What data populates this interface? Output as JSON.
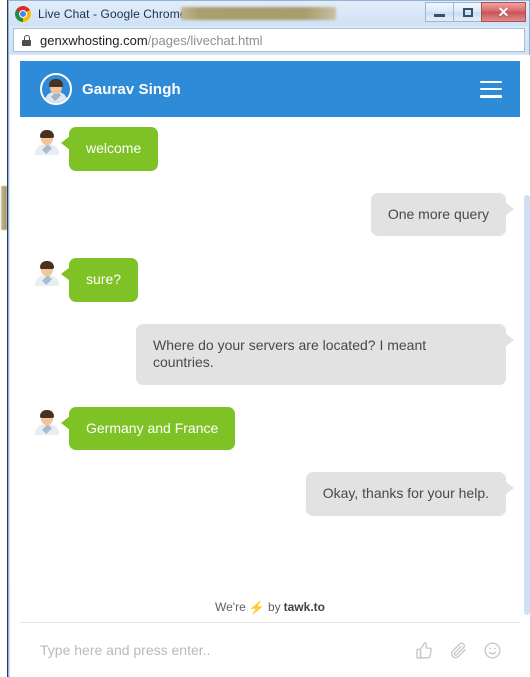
{
  "browser": {
    "window_title": "Live Chat - Google Chrome",
    "title_redacted": true,
    "controls": {
      "minimize_label": "–",
      "maximize_label": "□",
      "close_label": "✕"
    },
    "address_bar": {
      "lock_icon": "lock-icon",
      "host": "genxwhosting.com",
      "path": "/pages/livechat.html"
    }
  },
  "chat": {
    "header": {
      "agent_name": "Gaurav Singh",
      "avatar_icon": "user-avatar-icon",
      "menu_icon": "hamburger-icon",
      "background_color": "#2e8bd8"
    },
    "messages": [
      {
        "sender": "agent",
        "text": "welcome",
        "bubble_color": "#7ec225",
        "has_avatar": true
      },
      {
        "sender": "visitor",
        "text": "One more query",
        "bubble_color": "#e2e2e2",
        "has_avatar": false
      },
      {
        "sender": "agent",
        "text": "sure?",
        "bubble_color": "#7ec225",
        "has_avatar": true
      },
      {
        "sender": "visitor",
        "text": "Where do your servers are located? I meant countries.",
        "bubble_color": "#e2e2e2",
        "has_avatar": false
      },
      {
        "sender": "agent",
        "text": "Germany and France",
        "bubble_color": "#7ec225",
        "has_avatar": true
      },
      {
        "sender": "visitor",
        "text": "Okay, thanks for your help.",
        "bubble_color": "#e2e2e2",
        "has_avatar": false
      }
    ],
    "branding": {
      "prefix": "We're",
      "bolt_icon": "lightning-bolt-icon",
      "middle": "by",
      "brand": "tawk.to"
    },
    "composer": {
      "placeholder": "Type here and press enter..",
      "value": "",
      "actions": [
        {
          "icon": "thumbs-up-icon"
        },
        {
          "icon": "paperclip-icon"
        },
        {
          "icon": "emoji-smiley-icon"
        }
      ]
    }
  }
}
